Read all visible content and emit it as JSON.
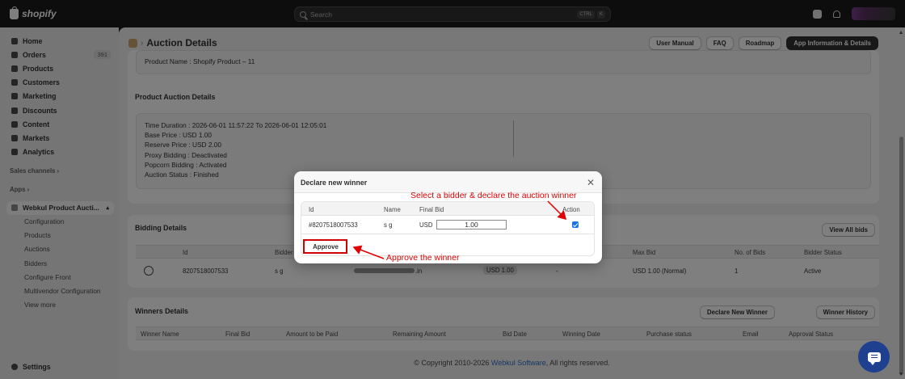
{
  "topbar": {
    "brand": "shopify",
    "search_placeholder": "Search",
    "shortcut_keys": [
      "CTRL",
      "K"
    ]
  },
  "sidebar": {
    "items": [
      {
        "label": "Home",
        "icon": "home-icon"
      },
      {
        "label": "Orders",
        "icon": "orders-icon",
        "badge": "391"
      },
      {
        "label": "Products",
        "icon": "tag-icon"
      },
      {
        "label": "Customers",
        "icon": "person-icon"
      },
      {
        "label": "Marketing",
        "icon": "target-icon"
      },
      {
        "label": "Discounts",
        "icon": "discount-icon"
      },
      {
        "label": "Content",
        "icon": "content-icon"
      },
      {
        "label": "Markets",
        "icon": "globe-icon"
      },
      {
        "label": "Analytics",
        "icon": "chart-icon"
      }
    ],
    "sales_channels_label": "Sales channels",
    "apps_label": "Apps",
    "app_name": "Webkul Product Aucti...",
    "app_subitems": [
      "Configuration",
      "Products",
      "Auctions",
      "Bidders",
      "Configure Front",
      "Multivendor Configuration",
      "View more"
    ],
    "settings_label": "Settings"
  },
  "header": {
    "title": "Auction Details",
    "buttons": [
      "User Manual",
      "FAQ",
      "Roadmap",
      "App Information & Details"
    ]
  },
  "product": {
    "name_line": "Product Name : Shopify Product – 11"
  },
  "auction_details": {
    "title": "Product Auction Details",
    "lines": [
      "Time Duration : 2026-06-01 11:57:22 To 2026-06-01 12:05:01",
      "Base Price : USD 1.00",
      "Reserve Price : USD 2.00",
      "Proxy Bidding : Deactivated",
      "Popcorn Bidding : Activated",
      "Auction Status : Finished"
    ]
  },
  "bidding": {
    "title": "Bidding Details",
    "view_all": "View All bids",
    "headers": [
      "Id",
      "Bidder",
      "Max Bid",
      "No. of Bids",
      "Bidder Status"
    ],
    "row": {
      "id": "8207518007533",
      "bidder": "s g",
      "email_suffix": ".in",
      "bid": "USD 1.00",
      "dash": "-",
      "max_bid": "USD 1.00 (Normal)",
      "num_bids": "1",
      "status": "Active"
    }
  },
  "winners": {
    "title": "Winners Details",
    "declare_btn": "Declare New Winner",
    "history_btn": "Winner History",
    "headers": [
      "Winner Name",
      "Final Bid",
      "Amount to be Paid",
      "Remaining Amount",
      "Bid Date",
      "Winning Date",
      "Purchase status",
      "Email",
      "Approval Status"
    ]
  },
  "footer": {
    "prefix": "© Copyright 2010-2026 ",
    "link": "Webkul Software",
    "suffix": ", All rights reserved."
  },
  "modal": {
    "title": "Declare new winner",
    "headers": [
      "Id",
      "Name",
      "Final Bid",
      "Action"
    ],
    "row": {
      "id": "#8207518007533",
      "name": "s g",
      "currency": "USD",
      "bid_value": "1.00",
      "checked": true
    },
    "approve_label": "Approve"
  },
  "annotations": {
    "top": "Select a bidder & declare the auction winner",
    "bottom": "Approve the winner",
    "color": "#e00000"
  }
}
